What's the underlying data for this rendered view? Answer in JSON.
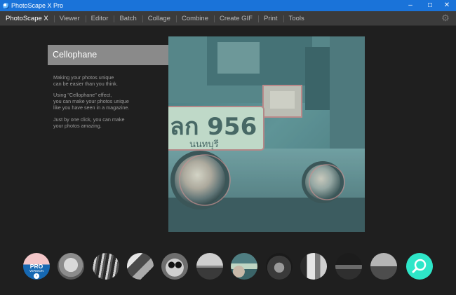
{
  "window": {
    "title": "PhotoScape X Pro",
    "minimize": "–",
    "maximize": "☐",
    "close": "✕"
  },
  "menu": {
    "items": [
      {
        "label": "PhotoScape X"
      },
      {
        "label": "Viewer"
      },
      {
        "label": "Editor"
      },
      {
        "label": "Batch"
      },
      {
        "label": "Collage"
      },
      {
        "label": "Combine"
      },
      {
        "label": "Create GIF"
      },
      {
        "label": "Print"
      },
      {
        "label": "Tools"
      }
    ],
    "settings_icon": "gear-icon"
  },
  "feature": {
    "title": "Cellophane",
    "paragraphs": [
      [
        "Making your photos unique",
        "can be easier than you think."
      ],
      [
        "Using \"Cellophane\" effect,",
        "you can make your photos unique",
        "like you have seen in a magazine."
      ],
      [
        "Just by one click, you can make",
        "your photos amazing."
      ]
    ],
    "photo": {
      "plate_line1": "ลก 956",
      "plate_line2": "นนทบุรี"
    }
  },
  "thumbnails": {
    "pro_badge": {
      "label": "PRO",
      "sublabel": "VERSION",
      "icon": "arrow-right-icon"
    },
    "search_icon": "search-icon"
  },
  "colors": {
    "titlebar": "#1a73d9",
    "menubar": "#3b3b3b",
    "background": "#1f1f1f",
    "title_box": "#8a8a8a",
    "search_button": "#2ee6c8",
    "pro_badge_top": "#f3c6c8",
    "pro_badge_bottom": "#1668b2"
  }
}
